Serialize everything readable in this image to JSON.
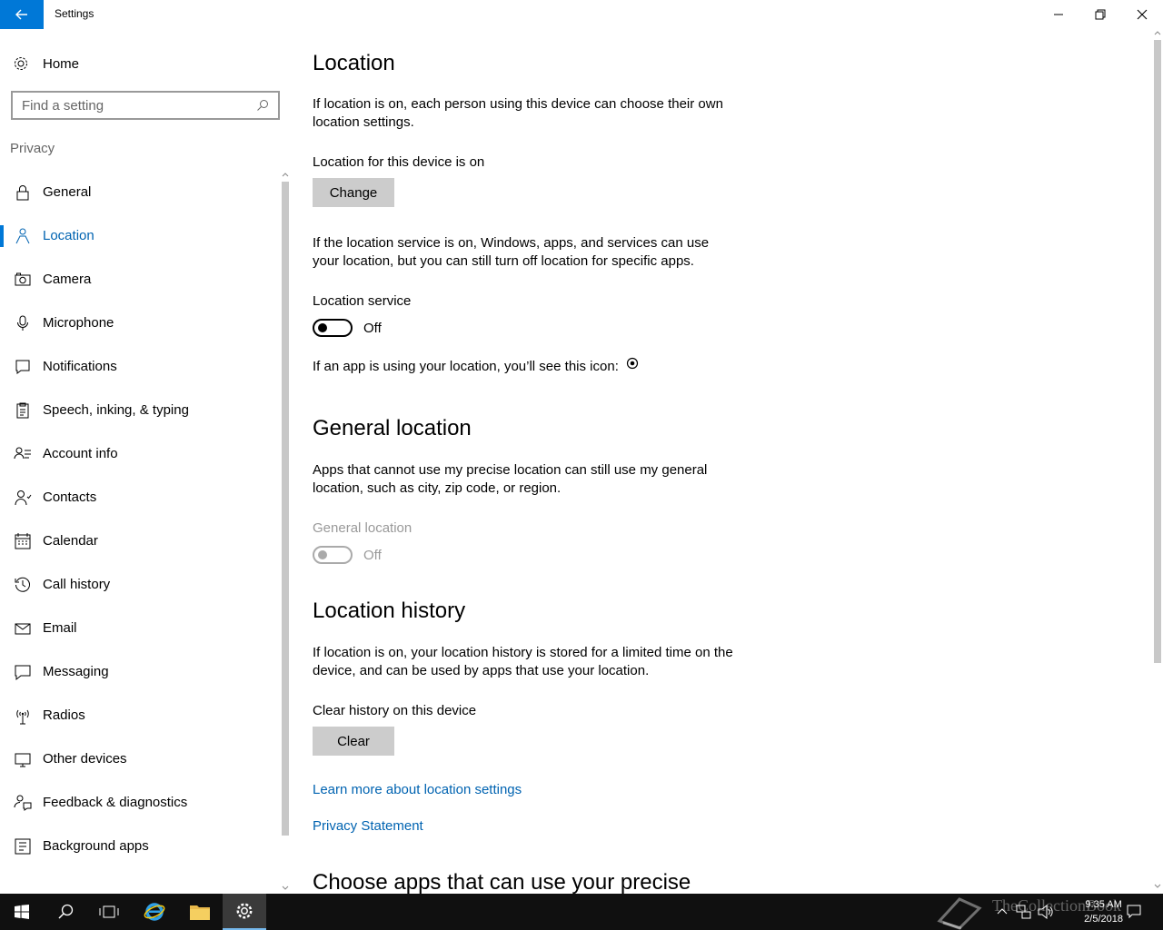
{
  "window": {
    "title": "Settings",
    "controls": [
      "minimize-icon",
      "restore-icon",
      "close-icon"
    ]
  },
  "sidebar": {
    "home_label": "Home",
    "search_placeholder": "Find a setting",
    "section_header": "Privacy",
    "items": [
      {
        "label": "General",
        "icon": "lock-icon"
      },
      {
        "label": "Location",
        "icon": "location-person-icon",
        "active": true
      },
      {
        "label": "Camera",
        "icon": "camera-icon"
      },
      {
        "label": "Microphone",
        "icon": "microphone-icon"
      },
      {
        "label": "Notifications",
        "icon": "notifications-icon"
      },
      {
        "label": "Speech, inking, & typing",
        "icon": "clipboard-icon"
      },
      {
        "label": "Account info",
        "icon": "account-info-icon"
      },
      {
        "label": "Contacts",
        "icon": "contacts-icon"
      },
      {
        "label": "Calendar",
        "icon": "calendar-icon"
      },
      {
        "label": "Call history",
        "icon": "history-icon"
      },
      {
        "label": "Email",
        "icon": "email-icon"
      },
      {
        "label": "Messaging",
        "icon": "messaging-icon"
      },
      {
        "label": "Radios",
        "icon": "radios-icon"
      },
      {
        "label": "Other devices",
        "icon": "devices-icon"
      },
      {
        "label": "Feedback & diagnostics",
        "icon": "feedback-icon"
      },
      {
        "label": "Background apps",
        "icon": "background-apps-icon"
      }
    ]
  },
  "main": {
    "location": {
      "title": "Location",
      "intro": "If location is on, each person using this device can choose their own location settings.",
      "device_status": "Location for this device is on",
      "change_label": "Change",
      "service_desc": "If the location service is on, Windows, apps, and services can use your location, but you can still turn off location for specific apps.",
      "service_label": "Location service",
      "service_state": "Off",
      "icon_note": "If an app is using your location, you’ll see this icon:"
    },
    "general_location": {
      "title": "General location",
      "desc": "Apps that cannot use my precise location can still use my general location, such as city, zip code, or region.",
      "toggle_label": "General location",
      "toggle_state": "Off"
    },
    "history": {
      "title": "Location history",
      "desc": "If location is on, your location history is stored for a limited time on the device, and can be used by apps that use your location.",
      "clear_label_text": "Clear history on this device",
      "clear_button": "Clear"
    },
    "links": {
      "learn_more": "Learn more about location settings",
      "privacy": "Privacy Statement"
    },
    "next_section_title": "Choose apps that can use your precise"
  },
  "taskbar": {
    "time": "9:35 AM",
    "date": "2/5/2018",
    "watermark": "TheCollectionBook",
    "accent": "#0078d7"
  }
}
